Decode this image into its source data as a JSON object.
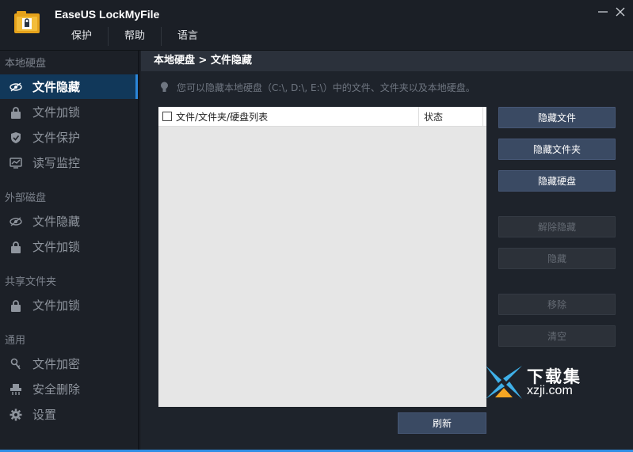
{
  "app": {
    "title": "EaseUS LockMyFile",
    "accent_color": "#2f8ee5"
  },
  "menu": [
    "保护",
    "帮助",
    "语言"
  ],
  "window_controls": {
    "minimize": "—",
    "close": "✕"
  },
  "sidebar": {
    "sections": [
      {
        "label": "本地硬盘",
        "items": [
          {
            "label": "文件隐藏",
            "icon": "eye-slash-icon",
            "active": true
          },
          {
            "label": "文件加锁",
            "icon": "lock-icon"
          },
          {
            "label": "文件保护",
            "icon": "shield-icon"
          },
          {
            "label": "读写监控",
            "icon": "monitor-icon"
          }
        ]
      },
      {
        "label": "外部磁盘",
        "items": [
          {
            "label": "文件隐藏",
            "icon": "eye-slash-icon"
          },
          {
            "label": "文件加锁",
            "icon": "lock-icon"
          }
        ]
      },
      {
        "label": "共享文件夹",
        "items": [
          {
            "label": "文件加锁",
            "icon": "lock-icon"
          }
        ]
      },
      {
        "label": "通用",
        "items": [
          {
            "label": "文件加密",
            "icon": "encrypt-key-icon"
          },
          {
            "label": "安全删除",
            "icon": "shredder-icon"
          },
          {
            "label": "设置",
            "icon": "gear-icon"
          }
        ]
      }
    ]
  },
  "main": {
    "breadcrumb": "本地硬盘 > 文件隐藏",
    "hint": "您可以隐藏本地硬盘（C:\\, D:\\, E:\\）中的文件、文件夹以及本地硬盘。",
    "list": {
      "columns": [
        "文件/文件夹/硬盘列表",
        "状态"
      ],
      "rows": []
    },
    "buttons": {
      "hide_file": "隐藏文件",
      "hide_folder": "隐藏文件夹",
      "hide_drive": "隐藏硬盘",
      "unhide": "解除隐藏",
      "hide": "隐藏",
      "remove": "移除",
      "clear": "清空",
      "refresh": "刷新"
    }
  },
  "watermark": {
    "cn": "下载集",
    "en": "xzji.com"
  }
}
